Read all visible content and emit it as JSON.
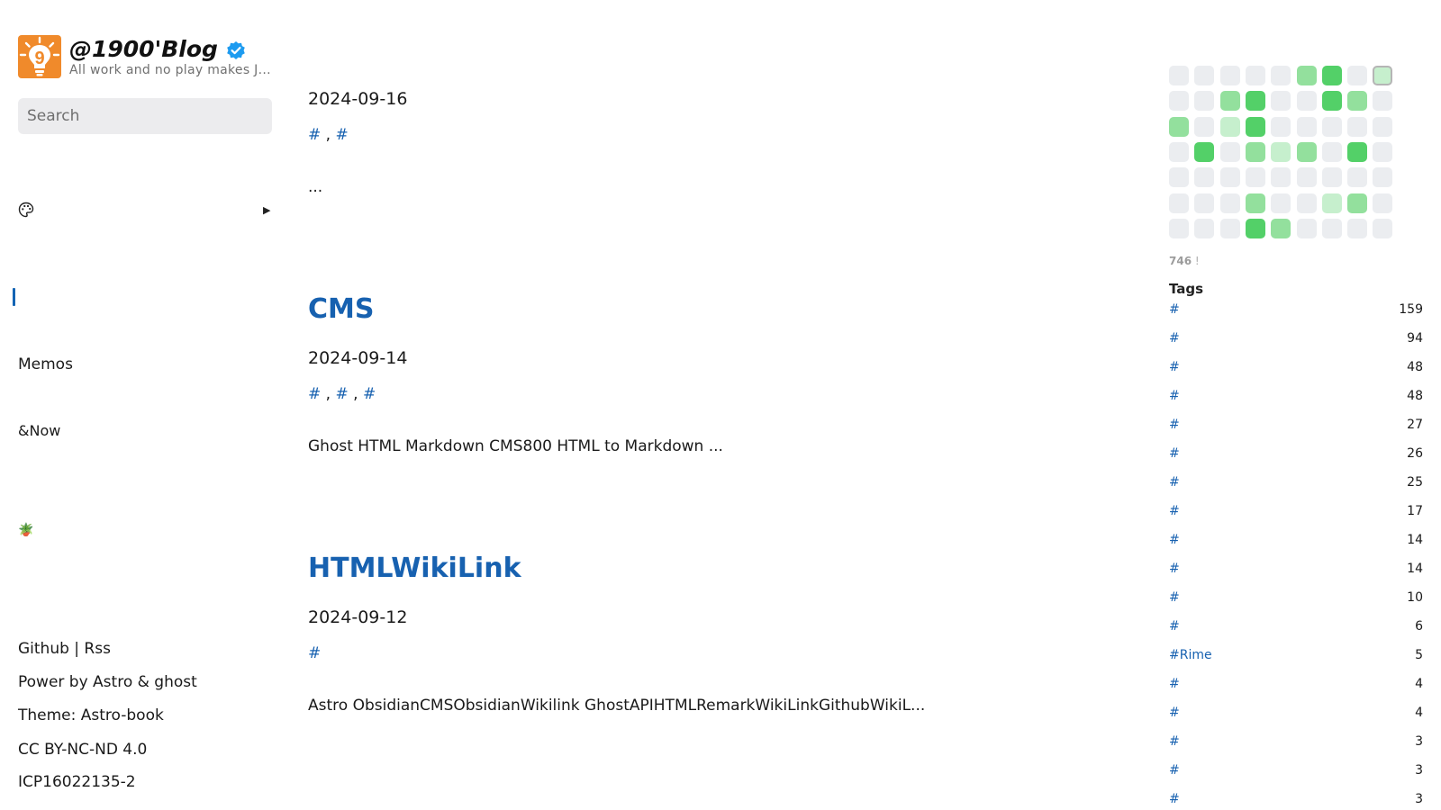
{
  "site": {
    "title": "@1900'Blog",
    "subtitle": "All work and no play makes J...",
    "logo_icon": "light-bulb-9-logo",
    "verified_icon": "verified-badge-icon"
  },
  "search": {
    "placeholder": "Search",
    "value": ""
  },
  "nav": {
    "items": [
      {
        "label": "",
        "active": false
      },
      {
        "label": "",
        "active": false,
        "has_submenu": true,
        "icon": "palette-icon"
      },
      {
        "label": "",
        "active": false
      },
      {
        "label": "",
        "active": true
      },
      {
        "label": "",
        "active": false
      },
      {
        "label": "Memos",
        "active": false
      },
      {
        "label": "",
        "active": false
      },
      {
        "label": "&Now",
        "active": false
      },
      {
        "label": "",
        "active": false
      },
      {
        "label": "",
        "active": false
      },
      {
        "label": "🪴",
        "active": false
      },
      {
        "label": "",
        "active": false
      },
      {
        "label": "",
        "active": false
      },
      {
        "label": "Github | Rss",
        "active": false
      },
      {
        "label": "Power by Astro & ghost",
        "active": false
      },
      {
        "label": "Theme: Astro-book",
        "active": false
      },
      {
        "label": "CC BY-NC-ND 4.0",
        "active": false
      },
      {
        "label": "ICP16022135-2",
        "active": false
      }
    ],
    "submenu_caret": "▶"
  },
  "posts": [
    {
      "title": "",
      "date": "2024-09-16",
      "tags": [
        "#",
        "#"
      ],
      "excerpt": "      ..."
    },
    {
      "title": "CMS",
      "date": "2024-09-14",
      "tags": [
        "#",
        "#",
        "#"
      ],
      "excerpt": "Ghost HTML  Markdown CMS800 HTML to Markdown ..."
    },
    {
      "title": "HTMLWikiLink",
      "date": "2024-09-12",
      "tags": [
        "#"
      ],
      "excerpt": " Astro ObsidianCMSObsidianWikilink GhostAPIHTMLRemarkWikiLinkGithubWikiL..."
    }
  ],
  "heatmap": {
    "title": "",
    "week_labels": [
      "",
      "",
      "",
      ""
    ],
    "levels": [
      [
        0,
        0,
        0,
        0,
        0,
        2,
        3,
        0,
        1
      ],
      [
        0,
        0,
        2,
        3,
        0,
        0,
        3,
        2,
        0
      ],
      [
        2,
        0,
        1,
        3,
        0,
        0,
        0,
        0,
        0
      ],
      [
        0,
        3,
        0,
        2,
        1,
        2,
        0,
        3,
        0
      ],
      [
        0,
        0,
        0,
        0,
        0,
        0,
        0,
        0,
        0
      ],
      [
        0,
        0,
        0,
        2,
        0,
        0,
        1,
        2,
        0
      ],
      [
        0,
        0,
        0,
        3,
        2,
        0,
        0,
        0,
        0
      ]
    ],
    "highlight_cell": "row 0, column 8",
    "colors": [
      "#ebedf0",
      "#c6efcd",
      "#93e09d",
      "#53d068"
    ],
    "note_prefix": "",
    "note_count": "746",
    "note_suffix": "!"
  },
  "tags_panel": {
    "title": "Tags",
    "items": [
      {
        "name": "#",
        "count": "159"
      },
      {
        "name": "#",
        "count": "94"
      },
      {
        "name": "#",
        "count": "48"
      },
      {
        "name": "#",
        "count": "48"
      },
      {
        "name": "#",
        "count": "27"
      },
      {
        "name": "#",
        "count": "26"
      },
      {
        "name": "#",
        "count": "25"
      },
      {
        "name": "#",
        "count": "17"
      },
      {
        "name": "#",
        "count": "14"
      },
      {
        "name": "#",
        "count": "14"
      },
      {
        "name": "#",
        "count": "10"
      },
      {
        "name": "#",
        "count": "6"
      },
      {
        "name": "#Rime",
        "count": "5"
      },
      {
        "name": "#",
        "count": "4"
      },
      {
        "name": "#",
        "count": "4"
      },
      {
        "name": "#",
        "count": "3"
      },
      {
        "name": "#",
        "count": "3"
      },
      {
        "name": "#",
        "count": "3"
      }
    ]
  },
  "colors": {
    "link": "#1761b0",
    "active": "#1464b4",
    "logo_orange": "#f08a2b"
  }
}
